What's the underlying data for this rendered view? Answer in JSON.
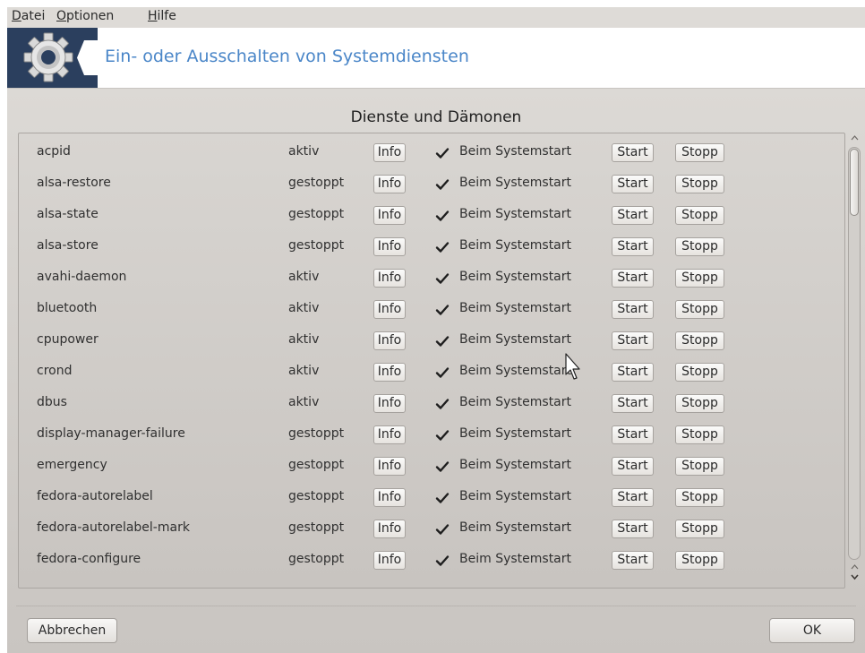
{
  "menubar": {
    "items": [
      {
        "underlined": "D",
        "rest": "atei"
      },
      {
        "underlined": "O",
        "rest": "ptionen"
      },
      {
        "underlined": "H",
        "rest": "ilfe"
      }
    ]
  },
  "banner": {
    "icon": "gear-icon",
    "title": "Ein- oder Ausschalten von Systemdiensten",
    "colors": {
      "icon_bg": "#2b3f5e",
      "title": "#4a86c8"
    }
  },
  "section_title": "Dienste und Dämonen",
  "labels": {
    "info": "Info",
    "boot": "Beim Systemstart",
    "start": "Start",
    "stop": "Stopp"
  },
  "services": [
    {
      "name": "acpid",
      "state": "aktiv",
      "on_boot": true
    },
    {
      "name": "alsa-restore",
      "state": "gestoppt",
      "on_boot": true
    },
    {
      "name": "alsa-state",
      "state": "gestoppt",
      "on_boot": true
    },
    {
      "name": "alsa-store",
      "state": "gestoppt",
      "on_boot": true
    },
    {
      "name": "avahi-daemon",
      "state": "aktiv",
      "on_boot": true
    },
    {
      "name": "bluetooth",
      "state": "aktiv",
      "on_boot": true
    },
    {
      "name": "cpupower",
      "state": "aktiv",
      "on_boot": true
    },
    {
      "name": "crond",
      "state": "aktiv",
      "on_boot": true
    },
    {
      "name": "dbus",
      "state": "aktiv",
      "on_boot": true
    },
    {
      "name": "display-manager-failure",
      "state": "gestoppt",
      "on_boot": true
    },
    {
      "name": "emergency",
      "state": "gestoppt",
      "on_boot": true
    },
    {
      "name": "fedora-autorelabel",
      "state": "gestoppt",
      "on_boot": true
    },
    {
      "name": "fedora-autorelabel-mark",
      "state": "gestoppt",
      "on_boot": true
    },
    {
      "name": "fedora-configure",
      "state": "gestoppt",
      "on_boot": true
    }
  ],
  "scrollbar": {
    "position_fraction": 0.0,
    "visible_fraction": 0.16
  },
  "footer": {
    "cancel_label": "Abbrechen",
    "ok_label": "OK"
  }
}
